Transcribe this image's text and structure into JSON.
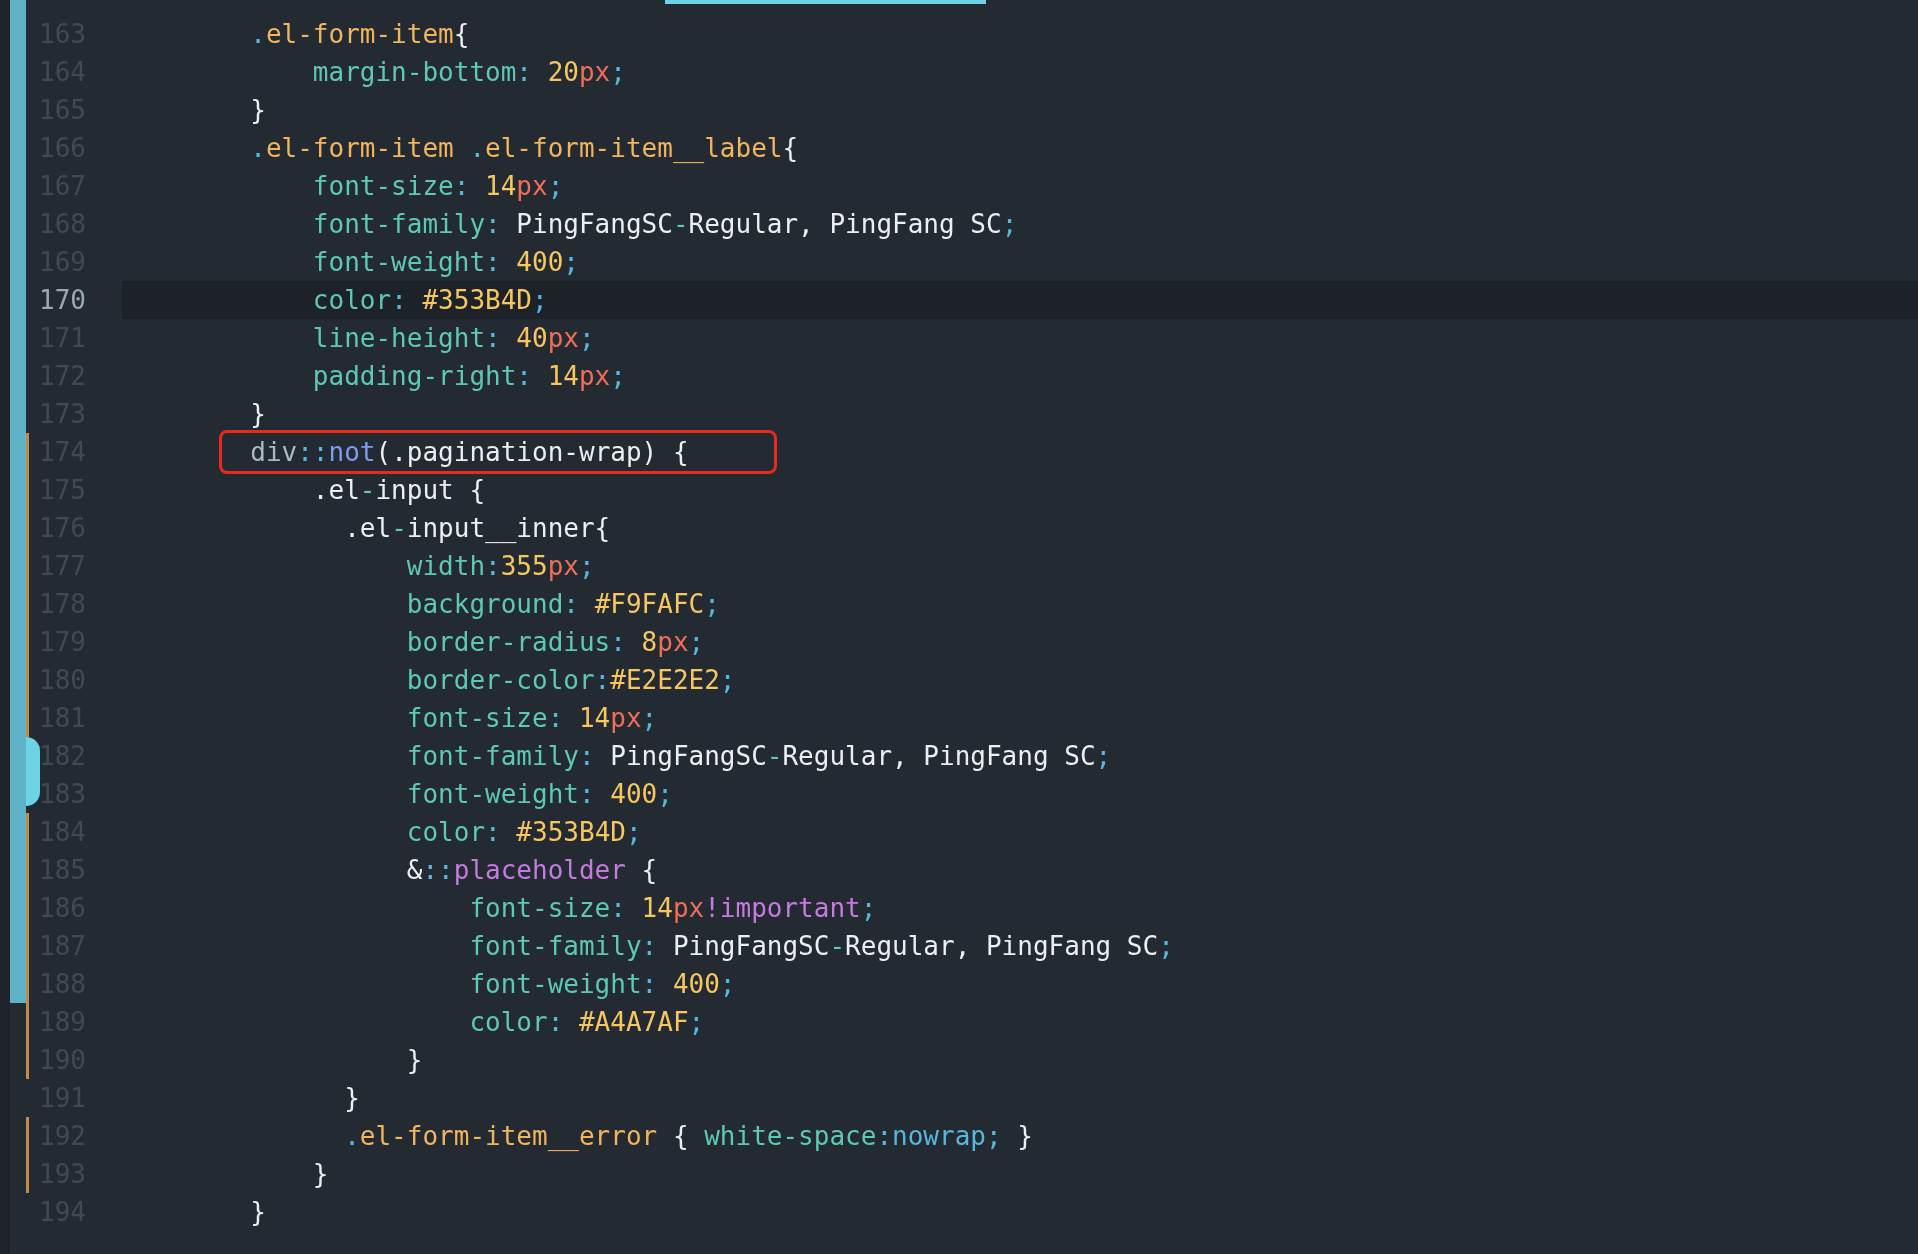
{
  "editor": {
    "lines": [
      {
        "number": "163",
        "current": false,
        "annotated": false,
        "scope_bar": true,
        "change_mark": false,
        "tokens": [
          {
            "text": "        .",
            "kind": "dot"
          },
          {
            "text": "el-form-item",
            "kind": "selector"
          },
          {
            "text": "{",
            "kind": "plain"
          }
        ]
      },
      {
        "number": "164",
        "current": false,
        "annotated": false,
        "scope_bar": true,
        "change_mark": false,
        "tokens": [
          {
            "text": "            margin-bottom",
            "kind": "prop"
          },
          {
            "text": ": ",
            "kind": "punct"
          },
          {
            "text": "20",
            "kind": "num"
          },
          {
            "text": "px",
            "kind": "unit"
          },
          {
            "text": ";",
            "kind": "punct"
          }
        ]
      },
      {
        "number": "165",
        "current": false,
        "annotated": false,
        "scope_bar": true,
        "change_mark": false,
        "tokens": [
          {
            "text": "        }",
            "kind": "plain"
          }
        ]
      },
      {
        "number": "166",
        "current": false,
        "annotated": false,
        "scope_bar": true,
        "change_mark": false,
        "tokens": [
          {
            "text": "        .el-form-item",
            "kind": "selector"
          },
          {
            "text": " .el-form-item__label",
            "kind": "selector"
          },
          {
            "text": "{",
            "kind": "plain"
          }
        ]
      },
      {
        "number": "167",
        "current": false,
        "annotated": false,
        "scope_bar": true,
        "change_mark": false,
        "tokens": [
          {
            "text": "            font-size",
            "kind": "prop"
          },
          {
            "text": ": ",
            "kind": "punct"
          },
          {
            "text": "14",
            "kind": "num"
          },
          {
            "text": "px",
            "kind": "unit"
          },
          {
            "text": ";",
            "kind": "punct"
          }
        ]
      },
      {
        "number": "168",
        "current": false,
        "annotated": false,
        "scope_bar": true,
        "change_mark": false,
        "tokens": [
          {
            "text": "            font-family",
            "kind": "prop"
          },
          {
            "text": ": ",
            "kind": "punct"
          },
          {
            "text": "PingFangSC",
            "kind": "plain"
          },
          {
            "text": "-",
            "kind": "prop"
          },
          {
            "text": "Regular, PingFang SC",
            "kind": "plain"
          },
          {
            "text": ";",
            "kind": "punct"
          }
        ]
      },
      {
        "number": "169",
        "current": false,
        "annotated": false,
        "scope_bar": true,
        "change_mark": false,
        "tokens": [
          {
            "text": "            font-weight",
            "kind": "prop"
          },
          {
            "text": ": ",
            "kind": "punct"
          },
          {
            "text": "400",
            "kind": "num"
          },
          {
            "text": ";",
            "kind": "punct"
          }
        ]
      },
      {
        "number": "170",
        "current": true,
        "annotated": false,
        "scope_bar": true,
        "change_mark": false,
        "tokens": [
          {
            "text": "            color",
            "kind": "prop"
          },
          {
            "text": ": ",
            "kind": "punct"
          },
          {
            "text": "#353B4D",
            "kind": "num"
          },
          {
            "text": ";",
            "kind": "punct"
          }
        ]
      },
      {
        "number": "171",
        "current": false,
        "annotated": false,
        "scope_bar": true,
        "change_mark": false,
        "tokens": [
          {
            "text": "            line-height",
            "kind": "prop"
          },
          {
            "text": ": ",
            "kind": "punct"
          },
          {
            "text": "40",
            "kind": "num"
          },
          {
            "text": "px",
            "kind": "unit"
          },
          {
            "text": ";",
            "kind": "punct"
          }
        ]
      },
      {
        "number": "172",
        "current": false,
        "annotated": false,
        "scope_bar": true,
        "change_mark": false,
        "tokens": [
          {
            "text": "            padding-right",
            "kind": "prop"
          },
          {
            "text": ": ",
            "kind": "punct"
          },
          {
            "text": "14",
            "kind": "num"
          },
          {
            "text": "px",
            "kind": "unit"
          },
          {
            "text": ";",
            "kind": "punct"
          }
        ]
      },
      {
        "number": "173",
        "current": false,
        "annotated": false,
        "scope_bar": true,
        "change_mark": false,
        "tokens": [
          {
            "text": "        }",
            "kind": "plain"
          }
        ]
      },
      {
        "number": "174",
        "current": false,
        "annotated": true,
        "scope_bar": true,
        "change_mark": true,
        "tokens": [
          {
            "text": "        div",
            "kind": "tag"
          },
          {
            "text": "::",
            "kind": "punct"
          },
          {
            "text": "not",
            "kind": "keyword"
          },
          {
            "text": "(.pagination-wrap) {",
            "kind": "plain"
          }
        ]
      },
      {
        "number": "175",
        "current": false,
        "annotated": false,
        "scope_bar": true,
        "change_mark": true,
        "tokens": [
          {
            "text": "            .el",
            "kind": "plain"
          },
          {
            "text": "-",
            "kind": "prop"
          },
          {
            "text": "input {",
            "kind": "plain"
          }
        ]
      },
      {
        "number": "176",
        "current": false,
        "annotated": false,
        "scope_bar": true,
        "change_mark": true,
        "tokens": [
          {
            "text": "              .el",
            "kind": "plain"
          },
          {
            "text": "-",
            "kind": "prop"
          },
          {
            "text": "input__inner{",
            "kind": "plain"
          }
        ]
      },
      {
        "number": "177",
        "current": false,
        "annotated": false,
        "scope_bar": true,
        "change_mark": true,
        "tokens": [
          {
            "text": "                  width",
            "kind": "prop"
          },
          {
            "text": ":",
            "kind": "punct"
          },
          {
            "text": "355",
            "kind": "num"
          },
          {
            "text": "px",
            "kind": "unit"
          },
          {
            "text": ";",
            "kind": "punct"
          }
        ]
      },
      {
        "number": "178",
        "current": false,
        "annotated": false,
        "scope_bar": true,
        "change_mark": true,
        "tokens": [
          {
            "text": "                  background",
            "kind": "prop"
          },
          {
            "text": ": ",
            "kind": "punct"
          },
          {
            "text": "#F9FAFC",
            "kind": "num"
          },
          {
            "text": ";",
            "kind": "punct"
          }
        ]
      },
      {
        "number": "179",
        "current": false,
        "annotated": false,
        "scope_bar": true,
        "change_mark": true,
        "tokens": [
          {
            "text": "                  border-radius",
            "kind": "prop"
          },
          {
            "text": ": ",
            "kind": "punct"
          },
          {
            "text": "8",
            "kind": "num"
          },
          {
            "text": "px",
            "kind": "unit"
          },
          {
            "text": ";",
            "kind": "punct"
          }
        ]
      },
      {
        "number": "180",
        "current": false,
        "annotated": false,
        "scope_bar": true,
        "change_mark": true,
        "tokens": [
          {
            "text": "                  border-color",
            "kind": "prop"
          },
          {
            "text": ":",
            "kind": "punct"
          },
          {
            "text": "#E2E2E2",
            "kind": "num"
          },
          {
            "text": ";",
            "kind": "punct"
          }
        ]
      },
      {
        "number": "181",
        "current": false,
        "annotated": false,
        "scope_bar": true,
        "change_mark": true,
        "tokens": [
          {
            "text": "                  font-size",
            "kind": "prop"
          },
          {
            "text": ": ",
            "kind": "punct"
          },
          {
            "text": "14",
            "kind": "num"
          },
          {
            "text": "px",
            "kind": "unit"
          },
          {
            "text": ";",
            "kind": "punct"
          }
        ]
      },
      {
        "number": "182",
        "current": false,
        "annotated": false,
        "scope_bar": true,
        "change_mark": false,
        "tokens": [
          {
            "text": "                  font-family",
            "kind": "prop"
          },
          {
            "text": ": ",
            "kind": "punct"
          },
          {
            "text": "PingFangSC",
            "kind": "plain"
          },
          {
            "text": "-",
            "kind": "prop"
          },
          {
            "text": "Regular, PingFang SC",
            "kind": "plain"
          },
          {
            "text": ";",
            "kind": "punct"
          }
        ]
      },
      {
        "number": "183",
        "current": false,
        "annotated": false,
        "scope_bar": true,
        "change_mark": false,
        "tokens": [
          {
            "text": "                  font-weight",
            "kind": "prop"
          },
          {
            "text": ": ",
            "kind": "punct"
          },
          {
            "text": "400",
            "kind": "num"
          },
          {
            "text": ";",
            "kind": "punct"
          }
        ]
      },
      {
        "number": "184",
        "current": false,
        "annotated": false,
        "scope_bar": true,
        "change_mark": true,
        "tokens": [
          {
            "text": "                  color",
            "kind": "prop"
          },
          {
            "text": ": ",
            "kind": "punct"
          },
          {
            "text": "#353B4D",
            "kind": "num"
          },
          {
            "text": ";",
            "kind": "punct"
          }
        ]
      },
      {
        "number": "185",
        "current": false,
        "annotated": false,
        "scope_bar": true,
        "change_mark": true,
        "tokens": [
          {
            "text": "                  &",
            "kind": "plain"
          },
          {
            "text": "::",
            "kind": "punct"
          },
          {
            "text": "placeholder",
            "kind": "pseudo"
          },
          {
            "text": " {",
            "kind": "plain"
          }
        ]
      },
      {
        "number": "186",
        "current": false,
        "annotated": false,
        "scope_bar": true,
        "change_mark": true,
        "tokens": [
          {
            "text": "                      font-size",
            "kind": "prop"
          },
          {
            "text": ": ",
            "kind": "punct"
          },
          {
            "text": "14",
            "kind": "num"
          },
          {
            "text": "px",
            "kind": "unit"
          },
          {
            "text": "!important",
            "kind": "pseudo"
          },
          {
            "text": ";",
            "kind": "punct"
          }
        ]
      },
      {
        "number": "187",
        "current": false,
        "annotated": false,
        "scope_bar": true,
        "change_mark": true,
        "tokens": [
          {
            "text": "                      font-family",
            "kind": "prop"
          },
          {
            "text": ": ",
            "kind": "punct"
          },
          {
            "text": "PingFangSC",
            "kind": "plain"
          },
          {
            "text": "-",
            "kind": "prop"
          },
          {
            "text": "Regular, PingFang SC",
            "kind": "plain"
          },
          {
            "text": ";",
            "kind": "punct"
          }
        ]
      },
      {
        "number": "188",
        "current": false,
        "annotated": false,
        "scope_bar": true,
        "change_mark": true,
        "tokens": [
          {
            "text": "                      font-weight",
            "kind": "prop"
          },
          {
            "text": ": ",
            "kind": "punct"
          },
          {
            "text": "400",
            "kind": "num"
          },
          {
            "text": ";",
            "kind": "punct"
          }
        ]
      },
      {
        "number": "189",
        "current": false,
        "annotated": false,
        "scope_bar": false,
        "change_mark": true,
        "tokens": [
          {
            "text": "                      color",
            "kind": "prop"
          },
          {
            "text": ": ",
            "kind": "punct"
          },
          {
            "text": "#A4A7AF",
            "kind": "num"
          },
          {
            "text": ";",
            "kind": "punct"
          }
        ]
      },
      {
        "number": "190",
        "current": false,
        "annotated": false,
        "scope_bar": false,
        "change_mark": true,
        "tokens": [
          {
            "text": "                  }",
            "kind": "plain"
          }
        ]
      },
      {
        "number": "191",
        "current": false,
        "annotated": false,
        "scope_bar": false,
        "change_mark": false,
        "tokens": [
          {
            "text": "              }",
            "kind": "plain"
          }
        ]
      },
      {
        "number": "192",
        "current": false,
        "annotated": false,
        "scope_bar": false,
        "change_mark": true,
        "tokens": [
          {
            "text": "              .",
            "kind": "dot"
          },
          {
            "text": "el-form-item__error",
            "kind": "selector"
          },
          {
            "text": " { ",
            "kind": "plain"
          },
          {
            "text": "white-space",
            "kind": "prop"
          },
          {
            "text": ":",
            "kind": "punct"
          },
          {
            "text": "nowrap",
            "kind": "dot"
          },
          {
            "text": "; ",
            "kind": "punct"
          },
          {
            "text": "}",
            "kind": "plain"
          }
        ]
      },
      {
        "number": "193",
        "current": false,
        "annotated": false,
        "scope_bar": false,
        "change_mark": true,
        "tokens": [
          {
            "text": "            }",
            "kind": "plain"
          }
        ]
      },
      {
        "number": "194",
        "current": false,
        "annotated": false,
        "scope_bar": false,
        "change_mark": false,
        "tokens": [
          {
            "text": "        }",
            "kind": "plain"
          }
        ]
      }
    ]
  }
}
